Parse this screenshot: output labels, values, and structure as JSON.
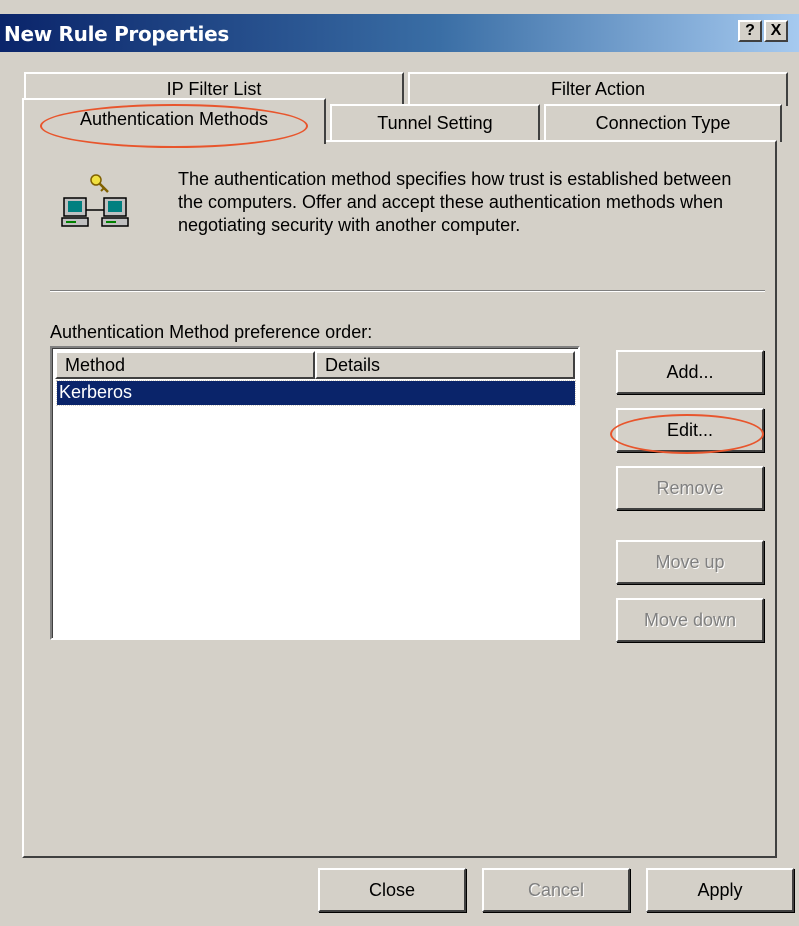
{
  "window": {
    "title": "New Rule Properties",
    "help_glyph": "?",
    "close_glyph": "X"
  },
  "tabs": {
    "row1": [
      {
        "label": "IP Filter List"
      },
      {
        "label": "Filter Action"
      }
    ],
    "row2": [
      {
        "label": "Authentication Methods",
        "active": true
      },
      {
        "label": "Tunnel Setting"
      },
      {
        "label": "Connection Type"
      }
    ]
  },
  "panel": {
    "icon": "computers-key-icon",
    "description": "The authentication method specifies how trust is established between the computers. Offer and accept these authentication methods when negotiating security with another computer.",
    "list_label": "Authentication Method preference order:",
    "columns": [
      "Method",
      "Details"
    ],
    "rows": [
      {
        "method": "Kerberos",
        "details": "",
        "selected": true
      }
    ]
  },
  "side_buttons": {
    "add": "Add...",
    "edit": "Edit...",
    "remove": "Remove",
    "move_up": "Move up",
    "move_down": "Move down"
  },
  "bottom_buttons": {
    "close": "Close",
    "cancel": "Cancel",
    "apply": "Apply"
  },
  "highlight_color": "#e8552c",
  "selection_color": "#0a246a"
}
